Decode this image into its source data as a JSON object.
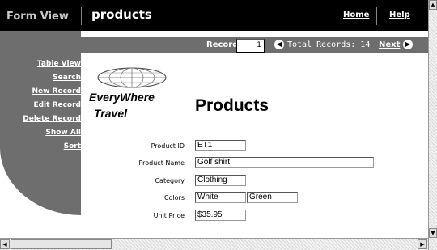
{
  "header": {
    "app_label": "Form View",
    "title": "products",
    "home_link": "Home",
    "help_link": "Help"
  },
  "record_bar": {
    "record_label": "Record",
    "record_value": "1",
    "total_records": "Total Records: 14",
    "next_label": "Next",
    "prev_icon": "left-arrow-circle-icon",
    "next_icon": "right-arrow-circle-icon"
  },
  "sidebar": {
    "items": [
      {
        "label": "Table View"
      },
      {
        "label": "Search"
      },
      {
        "label": "New Record"
      },
      {
        "label": "Edit Record"
      },
      {
        "label": "Delete Record"
      },
      {
        "label": "Show All"
      },
      {
        "label": "Sort"
      }
    ]
  },
  "logo": {
    "line1": "EveryWhere",
    "line2": "Travel",
    "icon": "globe-icon"
  },
  "page": {
    "heading": "Products"
  },
  "form": {
    "product_id": {
      "label": "Product ID",
      "value": "ET1"
    },
    "product_name": {
      "label": "Product Name",
      "value": "Golf shirt"
    },
    "category": {
      "label": "Category",
      "value": "Clothing"
    },
    "colors": {
      "label": "Colors",
      "values": [
        "White",
        "Green"
      ]
    },
    "unit_price": {
      "label": "Unit Price",
      "value": "$35.95"
    }
  },
  "colors": {
    "header_bg": "#000000",
    "bar_grey": "#6e6e6e",
    "accent_line": "#1a3fa0"
  }
}
